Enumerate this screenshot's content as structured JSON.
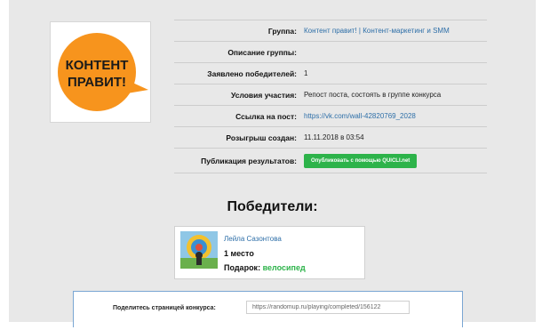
{
  "logo": {
    "line1": "КОНТЕНТ",
    "line2": "ПРАВИТ!",
    "circle_color": "#f7941d",
    "text_color": "#1a1a1a"
  },
  "info": {
    "rows": [
      {
        "label": "Группа:",
        "value": "Контент правит! | Контент-маркетинг и SMM"
      },
      {
        "label": "Описание группы:",
        "value": ""
      },
      {
        "label": "Заявлено победителей:",
        "value": "1"
      },
      {
        "label": "Условия участия:",
        "value": "Репост поста, состоять в группе конкурса"
      },
      {
        "label": "Ссылка на пост:",
        "value": "https://vk.com/wall-42820769_2028"
      },
      {
        "label": "Розыгрыш создан:",
        "value": "11.11.2018 в 03:54"
      },
      {
        "label": "Публикация результатов:",
        "button": "Опубликовать с помощью QUICLI.net"
      }
    ]
  },
  "winners": {
    "title": "Победители:",
    "items": [
      {
        "name": "Лейла Сазонтова",
        "place": "1 место",
        "prize_label": "Подарок:",
        "prize": "велосипед"
      }
    ]
  },
  "share": {
    "label": "Поделитесь страницей конкурса:",
    "url": "https://randomup.ru/playing/completed/156122"
  },
  "colors": {
    "link": "#2e6fa8",
    "accent_green": "#2db34a",
    "page_bg": "#e8e8e8",
    "share_border": "#7aa6d3"
  }
}
